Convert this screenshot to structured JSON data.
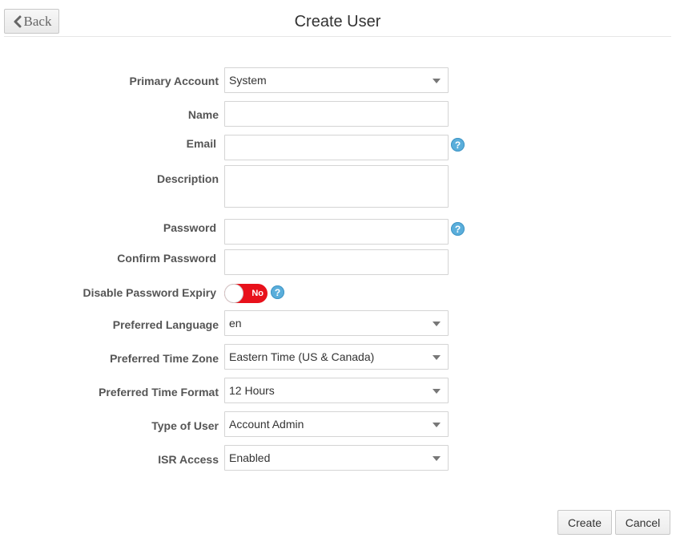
{
  "header": {
    "back_label": "Back",
    "title": "Create User"
  },
  "form": {
    "primary_account": {
      "label": "Primary Account",
      "value": "System"
    },
    "name": {
      "label": "Name",
      "value": ""
    },
    "email": {
      "label": "Email",
      "value": ""
    },
    "description": {
      "label": "Description",
      "value": ""
    },
    "password": {
      "label": "Password",
      "value": ""
    },
    "confirm_password": {
      "label": "Confirm Password",
      "value": ""
    },
    "disable_password_expiry": {
      "label": "Disable Password Expiry",
      "state": "No",
      "toggle_color": "#e8111b"
    },
    "preferred_language": {
      "label": "Preferred Language",
      "value": "en"
    },
    "preferred_time_zone": {
      "label": "Preferred Time Zone",
      "value": "Eastern Time (US & Canada)"
    },
    "preferred_time_format": {
      "label": "Preferred Time Format",
      "value": "12 Hours"
    },
    "type_of_user": {
      "label": "Type of User",
      "value": "Account Admin"
    },
    "isr_access": {
      "label": "ISR Access",
      "value": "Enabled"
    }
  },
  "help_glyph": "?",
  "icons": {
    "back": "chevron-left-icon",
    "help": "help-circle-icon",
    "dropdown": "caret-down-icon"
  },
  "footer": {
    "create_label": "Create",
    "cancel_label": "Cancel"
  }
}
